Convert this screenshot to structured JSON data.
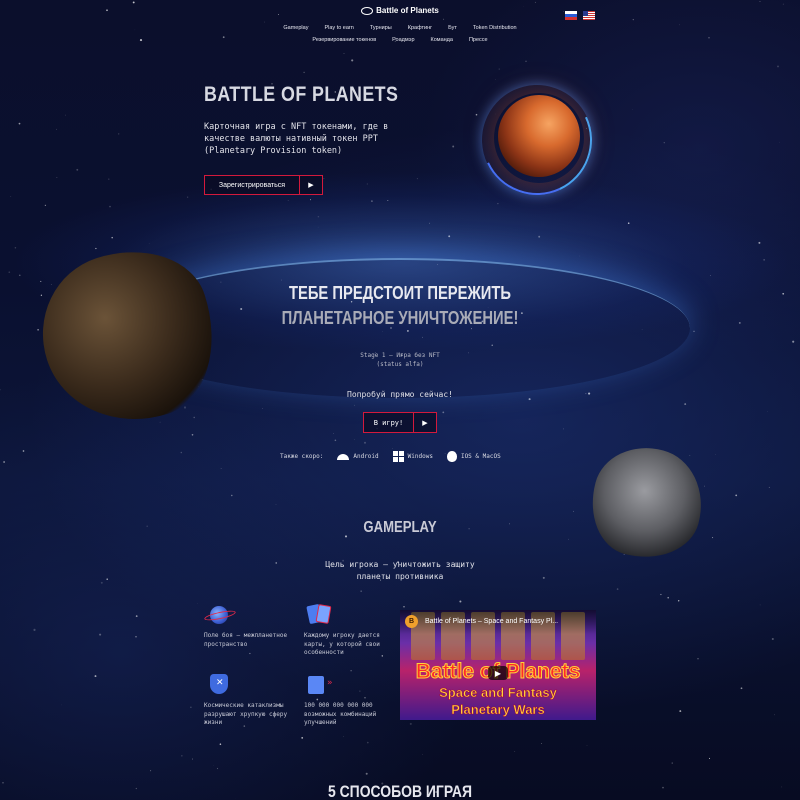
{
  "header": {
    "logo_text": "Battle of Planets",
    "nav_row1": [
      "Gameplay",
      "Play to earn",
      "Турниры",
      "Крафтинг",
      "Бут",
      "Token Distribution"
    ],
    "nav_row2": [
      "Резервирование токенов",
      "Роадмэр",
      "Команда",
      "Прессе"
    ],
    "languages": [
      "ru",
      "en"
    ]
  },
  "hero": {
    "title": "BATTLE OF PLANETS",
    "text": "Карточная игра с NFT токенами, где в качестве валюты нативный токен PPT (Planetary Provision token)",
    "register_button": "Зарегистрироваться",
    "arrow": "▶"
  },
  "destroy": {
    "line1": "ТЕБЕ ПРЕДСТОИТ ПЕРЕЖИТЬ",
    "line2": "ПЛАНЕТАРНОЕ УНИЧТОЖЕНИЕ!",
    "stage_line1": "Stage 1 – Игра без NFT",
    "stage_line2": "(status alfa)",
    "try_now": "Попробуй прямо сейчас!",
    "play_button": "В игру!",
    "soon_label": "Также скоро:",
    "platforms": [
      "Android",
      "Windows",
      "IOS & MacOS"
    ]
  },
  "gameplay": {
    "title": "GAMEPLAY",
    "subtitle_line1": "Цель игрока – уничтожить защиту",
    "subtitle_line2": "планеты противника",
    "features": [
      {
        "text": "Поле боя – межпланетное пространство",
        "icon": "planet-icon"
      },
      {
        "text": "Каждому игроку дается карты, у которой свои особенности",
        "icon": "cards-icon"
      },
      {
        "text": "Космические катаклизмы разрушают хрупкую сферу жизни",
        "icon": "shield-icon"
      },
      {
        "text": "100 000 000 000 000 возможных комбинаций улучшений",
        "icon": "upgrade-icon"
      }
    ],
    "video": {
      "channel_badge": "B",
      "title": "Battle of Planets – Space and Fantasy Pl...",
      "big_title": "Battle of Planets",
      "line2": "Space and Fantasy",
      "line3": "Planetary Wars",
      "play_icon": "▶"
    }
  },
  "next_section": {
    "title": "5 СПОСОБОВ ИГРАЯ"
  },
  "colors": {
    "accent_red": "#d3193c",
    "background": "#070b22"
  }
}
